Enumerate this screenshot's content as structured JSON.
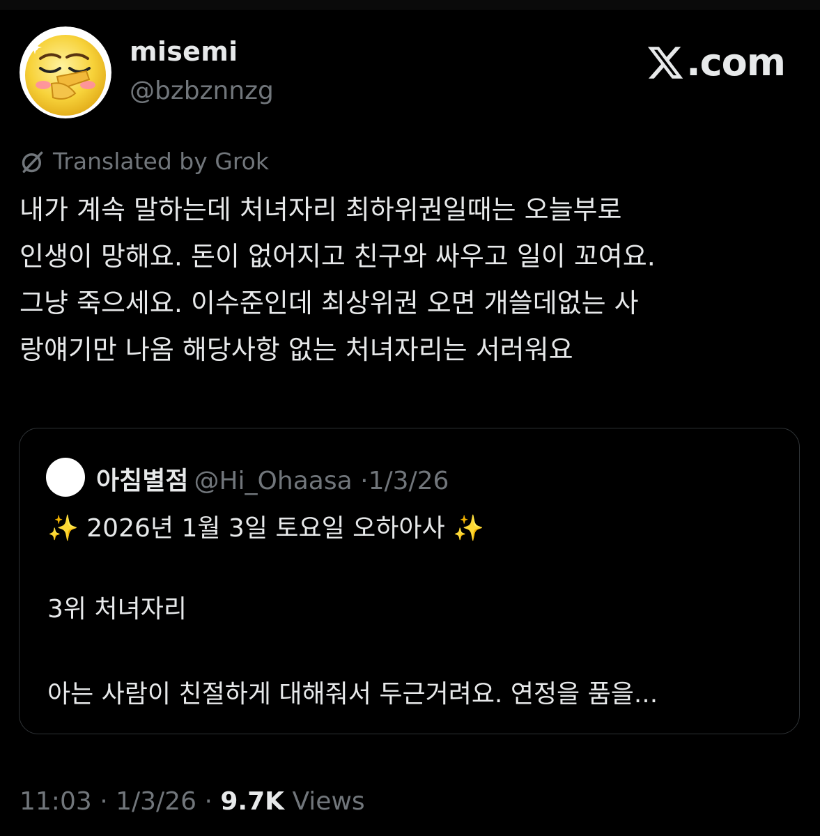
{
  "brand": {
    "label": "X.com",
    "icon": "x-logo-icon"
  },
  "author": {
    "display_name": "misemi",
    "handle": "@bzbznnzg",
    "avatar": "yellow-emoji-avatar"
  },
  "translation": {
    "icon": "grok-icon",
    "label": "Translated by Grok"
  },
  "tweet": {
    "lines": [
      "내가 계속 말하는데 처녀자리 최하위권일때는 오늘부로",
      "인생이 망해요. 돈이 없어지고 친구와 싸우고 일이 꼬여요.",
      "그냥 죽으세요. 이수준인데 최상위권 오면 개쓸데없는 사",
      "랑얘기만 나옴 해당사항 없는 처녀자리는 서러워요"
    ]
  },
  "quote": {
    "author_name": "아침별점",
    "author_handle": "@Hi_Ohaasa",
    "separator": "·",
    "date": "1/3/26",
    "line1": "✨ 2026년 1월 3일 토요일 오하아사 ✨",
    "line2": "3위 처녀자리",
    "line3": "아는 사람이 친절하게 대해줘서 두근거려요. 연정을 품을..."
  },
  "footer": {
    "time": "11:03",
    "separator": "·",
    "date": "1/3/26",
    "views_count": "9.7K",
    "views_label": "Views"
  },
  "colors": {
    "background": "#000000",
    "primary_text": "#e7e9ea",
    "secondary_text": "#71767b",
    "border": "#2f3336"
  }
}
